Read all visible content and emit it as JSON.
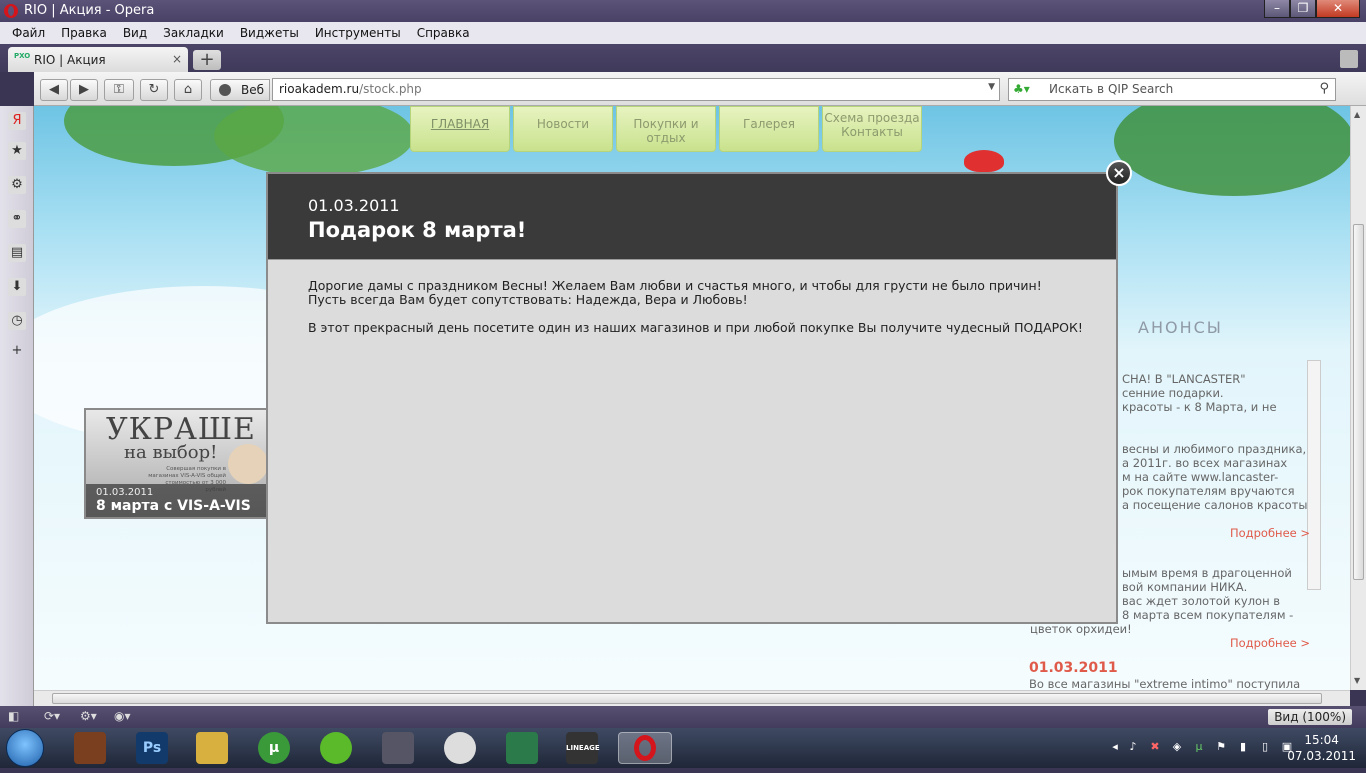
{
  "window": {
    "title": "RIO | Акция - Opera",
    "min": "–",
    "max": "❐",
    "close": "✕"
  },
  "menu": [
    "Файл",
    "Правка",
    "Вид",
    "Закладки",
    "Виджеты",
    "Инструменты",
    "Справка"
  ],
  "tab": {
    "label": "RIO | Акция",
    "favicon_text": "PXO",
    "close": "×",
    "new_tab": "+"
  },
  "address": {
    "web_label": "Веб",
    "url_domain": "rioakadem.ru",
    "url_path": "/stock.php",
    "search_placeholder": "Искать в QIP Search"
  },
  "site": {
    "nav": [
      "ГЛАВНАЯ",
      "Новости",
      "Покупки и отдых",
      "Галерея",
      "Схема проезда\nКонтакты"
    ],
    "announcements_title": "АНОНСЫ",
    "ann1_lines": [
      "СНА!  В \"LANCASTER\"",
      "сенние подарки.",
      "красоты - к 8 Марта, и не"
    ],
    "ann2_lines": [
      "весны и любимого праздника,",
      "а 2011г. во всех магазинах",
      "м на сайте www.lancaster-",
      "рок  покупателям вручаются",
      "а посещение салонов красоты"
    ],
    "more": "Подробнее >",
    "ann3_lines": [
      "ымым время в драгоценной",
      "вой компании НИКА.",
      "вас ждет золотой кулон в",
      "8 марта всем покупателям -"
    ],
    "ann3_tail": "цветок орхидеи!",
    "ann4_date": "01.03.2011",
    "ann4_text": "Во все магазины \"extreme intimo\" поступила",
    "promo": {
      "big": "УКРАШЕ",
      "sub": "на выбор!",
      "small": "Совершая покупки в магазинах VIS-A-VIS общей стоимостью от 3 000 рублей",
      "date": "01.03.2011",
      "title": "8 марта с VIS-A-VIS"
    }
  },
  "modal": {
    "date": "01.03.2011",
    "title": "Подарок 8 марта!",
    "line1": "Дорогие дамы с  праздником  Весны! Желаем Вам любви и счастья много, и чтобы для грусти не было причин!",
    "line2": "Пусть всегда Вам будет сопутствовать: Надежда, Вера и Любовь!",
    "line3": "В этот прекрасный день посетите один из наших магазинов и при любой покупке Вы получите чудесный ПОДАРОК!",
    "close": "×"
  },
  "status": {
    "zoom": "Вид (100%)"
  },
  "taskbar": {
    "items": [
      "Ps",
      "LINEAGE"
    ],
    "clock_time": "15:04",
    "clock_date": "07.03.2011"
  }
}
